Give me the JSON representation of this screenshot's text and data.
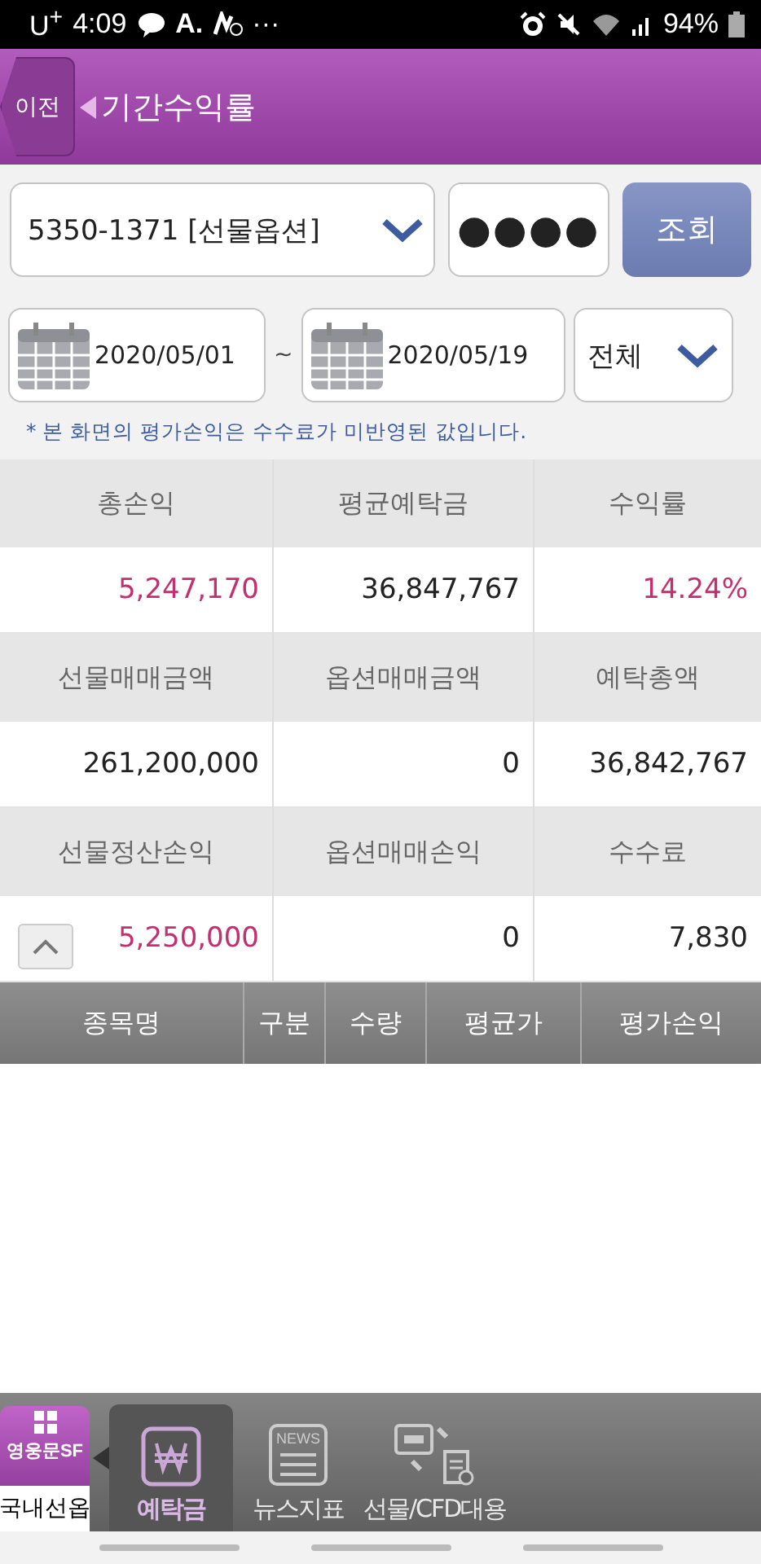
{
  "status_bar": {
    "carrier": "U",
    "carrier_sup": "+",
    "time": "4:09",
    "app_letter": "A.",
    "more": "···",
    "battery": "94%"
  },
  "header": {
    "back": "이전",
    "title": "기간수익률"
  },
  "account": {
    "value": "5350-1371 [선물옵션]",
    "password": "●●●●",
    "search_button": "조회"
  },
  "period": {
    "from": "2020/05/01",
    "separator": "~",
    "to": "2020/05/19",
    "filter": "전체"
  },
  "note": "* 본 화면의 평가손익은 수수료가 미반영된 값입니다.",
  "summary": [
    {
      "labels": [
        "총손익",
        "평균예탁금",
        "수익률"
      ],
      "values": [
        {
          "text": "5,247,170",
          "color": "#c2306f"
        },
        {
          "text": "36,847,767",
          "color": "#222222"
        },
        {
          "text": "14.24%",
          "color": "#c2306f"
        }
      ]
    },
    {
      "labels": [
        "선물매매금액",
        "옵션매매금액",
        "예탁총액"
      ],
      "values": [
        {
          "text": "261,200,000",
          "color": "#222222"
        },
        {
          "text": "0",
          "color": "#222222"
        },
        {
          "text": "36,842,767",
          "color": "#222222"
        }
      ]
    },
    {
      "labels": [
        "선물정산손익",
        "옵션매매손익",
        "수수료"
      ],
      "values": [
        {
          "text": "5,250,000",
          "color": "#c2306f"
        },
        {
          "text": "0",
          "color": "#222222"
        },
        {
          "text": "7,830",
          "color": "#222222"
        }
      ]
    }
  ],
  "table": {
    "columns": [
      "종목명",
      "구분",
      "수량",
      "평균가",
      "평가손익"
    ]
  },
  "bottom_nav": {
    "brand": {
      "logo": "영웅문SF",
      "label": "국내선옵"
    },
    "items": [
      {
        "kind": "won",
        "label": "예탁금",
        "selected": true
      },
      {
        "kind": "news",
        "label": "뉴스지표",
        "icon_text": "NEWS",
        "selected": false
      },
      {
        "kind": "transfer",
        "label": "선물/CFD대용",
        "selected": false
      }
    ]
  }
}
